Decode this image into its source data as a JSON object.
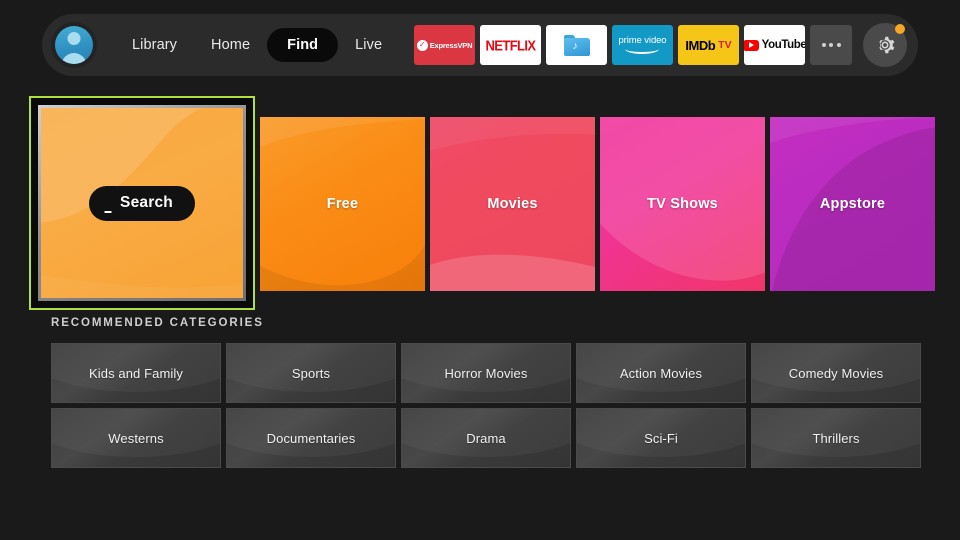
{
  "header": {
    "avatar_name": "profile-avatar",
    "nav": [
      {
        "label": "Library",
        "active": false
      },
      {
        "label": "Home",
        "active": false
      },
      {
        "label": "Find",
        "active": true
      },
      {
        "label": "Live",
        "active": false
      }
    ],
    "apps": [
      {
        "name": "expressvpn",
        "label": "ExpressVPN"
      },
      {
        "name": "netflix",
        "label": "NETFLIX"
      },
      {
        "name": "es-file-explorer",
        "label": ""
      },
      {
        "name": "prime-video",
        "label": "prime video"
      },
      {
        "name": "imdb-tv",
        "label": "IMDb",
        "label2": "TV"
      },
      {
        "name": "youtube",
        "label": "YouTube"
      }
    ],
    "more_label": "",
    "settings_label": "",
    "badge_color": "#f5a623"
  },
  "tiles": [
    {
      "name": "search",
      "label": "Search",
      "selected": true,
      "accent": "#aee03f"
    },
    {
      "name": "free",
      "label": "Free",
      "selected": false,
      "accent": "#f98d16"
    },
    {
      "name": "movies",
      "label": "Movies",
      "selected": false,
      "accent": "#ef4a62"
    },
    {
      "name": "tv-shows",
      "label": "TV Shows",
      "selected": false,
      "accent": "#f03498"
    },
    {
      "name": "appstore",
      "label": "Appstore",
      "selected": false,
      "accent": "#bb2cc1"
    }
  ],
  "recommended": {
    "title": "RECOMMENDED CATEGORIES",
    "categories": [
      "Kids and Family",
      "Sports",
      "Horror Movies",
      "Action Movies",
      "Comedy Movies",
      "Westerns",
      "Documentaries",
      "Drama",
      "Sci-Fi",
      "Thrillers"
    ]
  }
}
